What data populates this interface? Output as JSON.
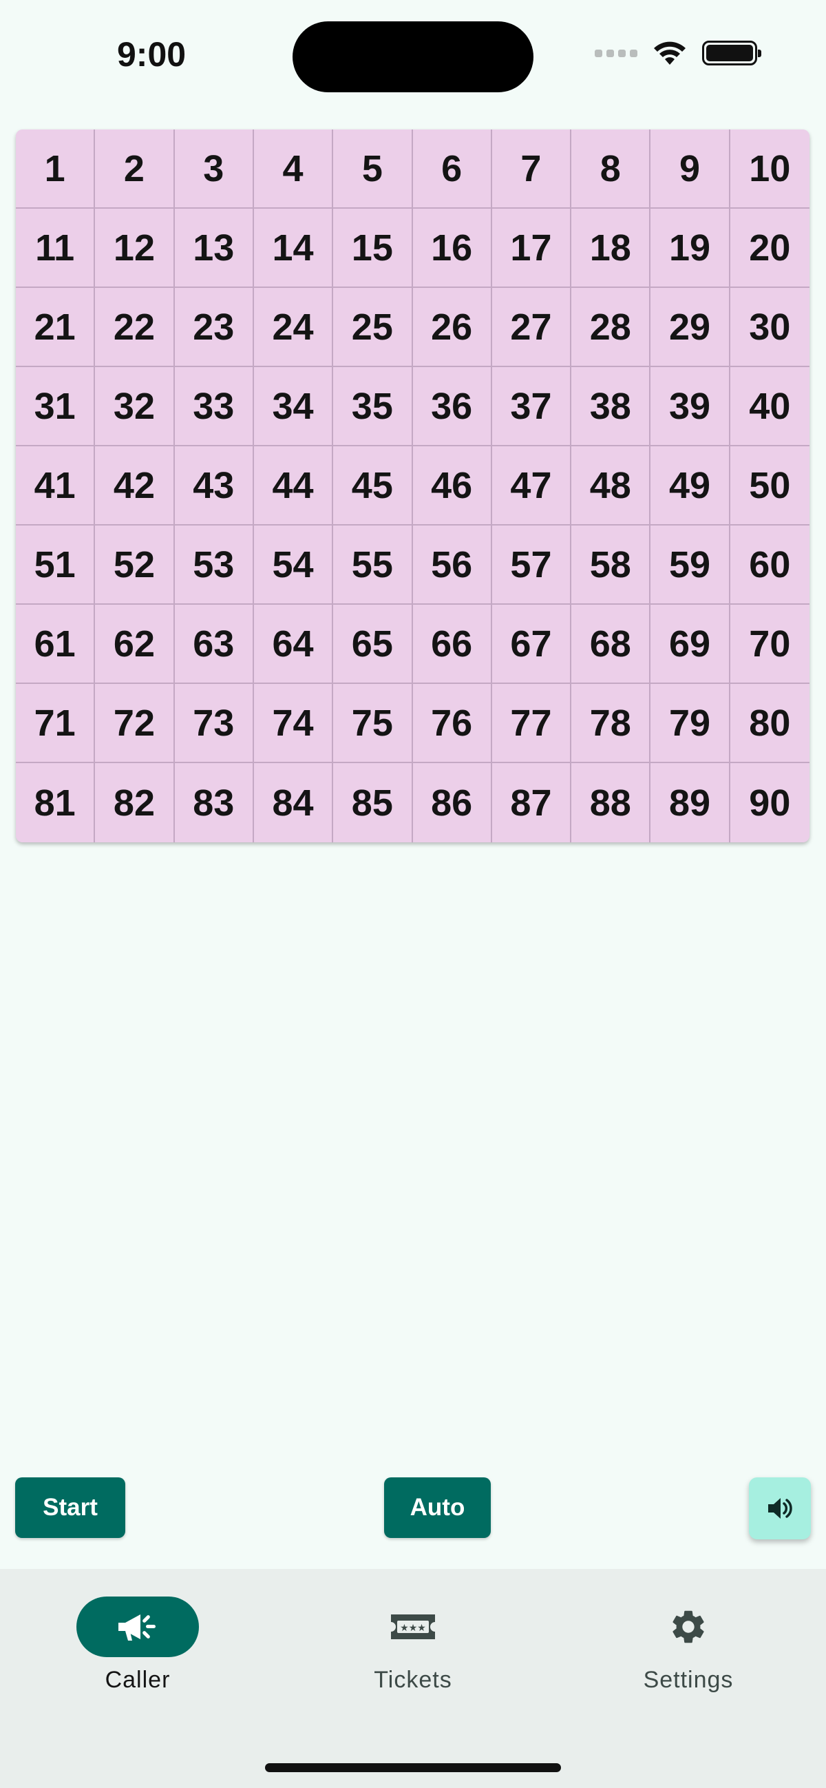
{
  "status_bar": {
    "time": "9:00"
  },
  "board": {
    "numbers": [
      "1",
      "2",
      "3",
      "4",
      "5",
      "6",
      "7",
      "8",
      "9",
      "10",
      "11",
      "12",
      "13",
      "14",
      "15",
      "16",
      "17",
      "18",
      "19",
      "20",
      "21",
      "22",
      "23",
      "24",
      "25",
      "26",
      "27",
      "28",
      "29",
      "30",
      "31",
      "32",
      "33",
      "34",
      "35",
      "36",
      "37",
      "38",
      "39",
      "40",
      "41",
      "42",
      "43",
      "44",
      "45",
      "46",
      "47",
      "48",
      "49",
      "50",
      "51",
      "52",
      "53",
      "54",
      "55",
      "56",
      "57",
      "58",
      "59",
      "60",
      "61",
      "62",
      "63",
      "64",
      "65",
      "66",
      "67",
      "68",
      "69",
      "70",
      "71",
      "72",
      "73",
      "74",
      "75",
      "76",
      "77",
      "78",
      "79",
      "80",
      "81",
      "82",
      "83",
      "84",
      "85",
      "86",
      "87",
      "88",
      "89",
      "90"
    ],
    "cell_color": "#eccfe9"
  },
  "controls": {
    "start_label": "Start",
    "auto_label": "Auto",
    "sound_icon": "volume-icon"
  },
  "nav": {
    "items": [
      {
        "label": "Caller",
        "icon": "megaphone-icon",
        "active": true
      },
      {
        "label": "Tickets",
        "icon": "ticket-icon",
        "active": false
      },
      {
        "label": "Settings",
        "icon": "gear-icon",
        "active": false
      }
    ]
  },
  "colors": {
    "background": "#f3fbf8",
    "primary": "#006b60",
    "accent": "#a6efe0",
    "nav_background": "#e9eeec"
  }
}
